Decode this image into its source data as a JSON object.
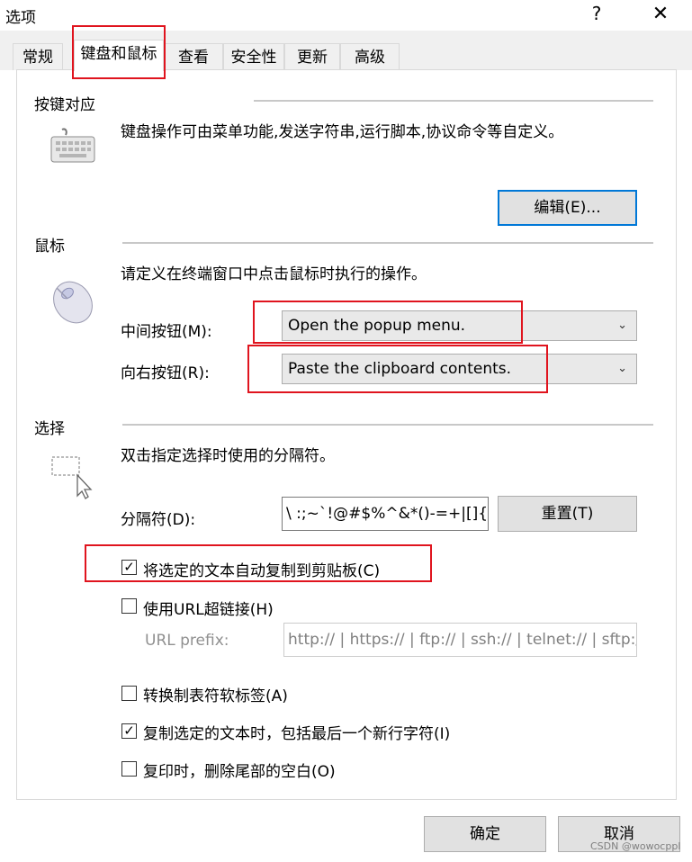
{
  "window": {
    "title": "选项",
    "help_label": "?",
    "close_label": "✕"
  },
  "tabs": [
    "常规",
    "键盘和鼠标",
    "查看",
    "安全性",
    "更新",
    "高级"
  ],
  "active_tab": "键盘和鼠标",
  "keymap": {
    "section": "按键对应",
    "icon": "keyboard-icon",
    "description": "键盘操作可由菜单功能,发送字符串,运行脚本,协议命令等自定义。",
    "edit_button": "编辑(E)..."
  },
  "mouse": {
    "section": "鼠标",
    "icon": "mouse-icon",
    "description": "请定义在终端窗口中点击鼠标时执行的操作。",
    "middle_label": "中间按钮(M):",
    "middle_value": "Open the popup menu.",
    "right_label": "向右按钮(R):",
    "right_value": "Paste the clipboard contents."
  },
  "selection": {
    "section": "选择",
    "icon": "selection-cursor-icon",
    "description": "双击指定选择时使用的分隔符。",
    "delimiter_label": "分隔符(D):",
    "delimiter_value": "\\ :;~`!@#$%^&*()-=+|[]{}'\"",
    "reset_button": "重置(T)",
    "auto_copy_label": "将选定的文本自动复制到剪贴板(C)",
    "auto_copy_checked": true,
    "url_link_label": "使用URL超链接(H)",
    "url_link_checked": false,
    "url_prefix_label": "URL prefix:",
    "url_prefix_value": "http:// | https:// | ftp:// | ssh:// | telnet:// | sftp://",
    "tab_convert_label": "转换制表符软标签(A)",
    "tab_convert_checked": false,
    "include_newline_label": "复制选定的文本时，包括最后一个新行字符(I)",
    "include_newline_checked": true,
    "trim_trailing_label": "复印时，删除尾部的空白(O)",
    "trim_trailing_checked": false
  },
  "footer": {
    "ok_button": "确定",
    "cancel_button": "取消",
    "watermark": "CSDN @wowocppl"
  },
  "colors": {
    "highlight": "#e0141e",
    "focus_border": "#0078d7"
  }
}
